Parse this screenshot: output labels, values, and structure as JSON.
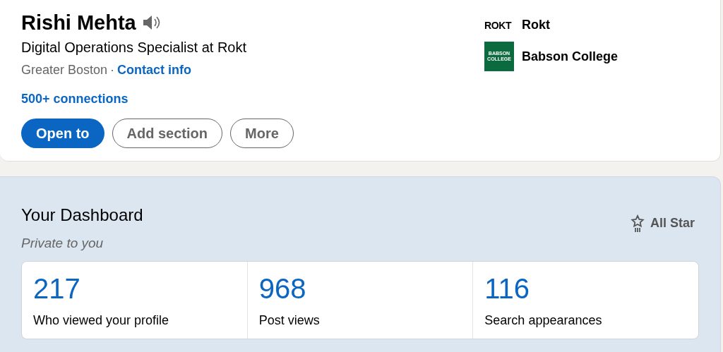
{
  "profile": {
    "name": "Rishi Mehta",
    "headline": "Digital Operations Specialist at Rokt",
    "location": "Greater Boston",
    "separator": "·",
    "contact_link": "Contact info",
    "connections": "500+ connections",
    "buttons": [
      {
        "label": "Open to",
        "kind": "primary"
      },
      {
        "label": "Add section",
        "kind": "secondary"
      },
      {
        "label": "More",
        "kind": "secondary"
      }
    ],
    "affiliations": [
      {
        "logo_text": "ROKT",
        "kind": "wordmark",
        "name": "Rokt"
      },
      {
        "logo_text": "BABSON COLLEGE",
        "kind": "square",
        "name": "Babson College"
      }
    ]
  },
  "dashboard": {
    "title": "Your Dashboard",
    "subtitle": "Private to you",
    "badge": "All Star",
    "stats": [
      {
        "value": "217",
        "label": "Who viewed your profile"
      },
      {
        "value": "968",
        "label": "Post views"
      },
      {
        "value": "116",
        "label": "Search appearances"
      }
    ]
  }
}
